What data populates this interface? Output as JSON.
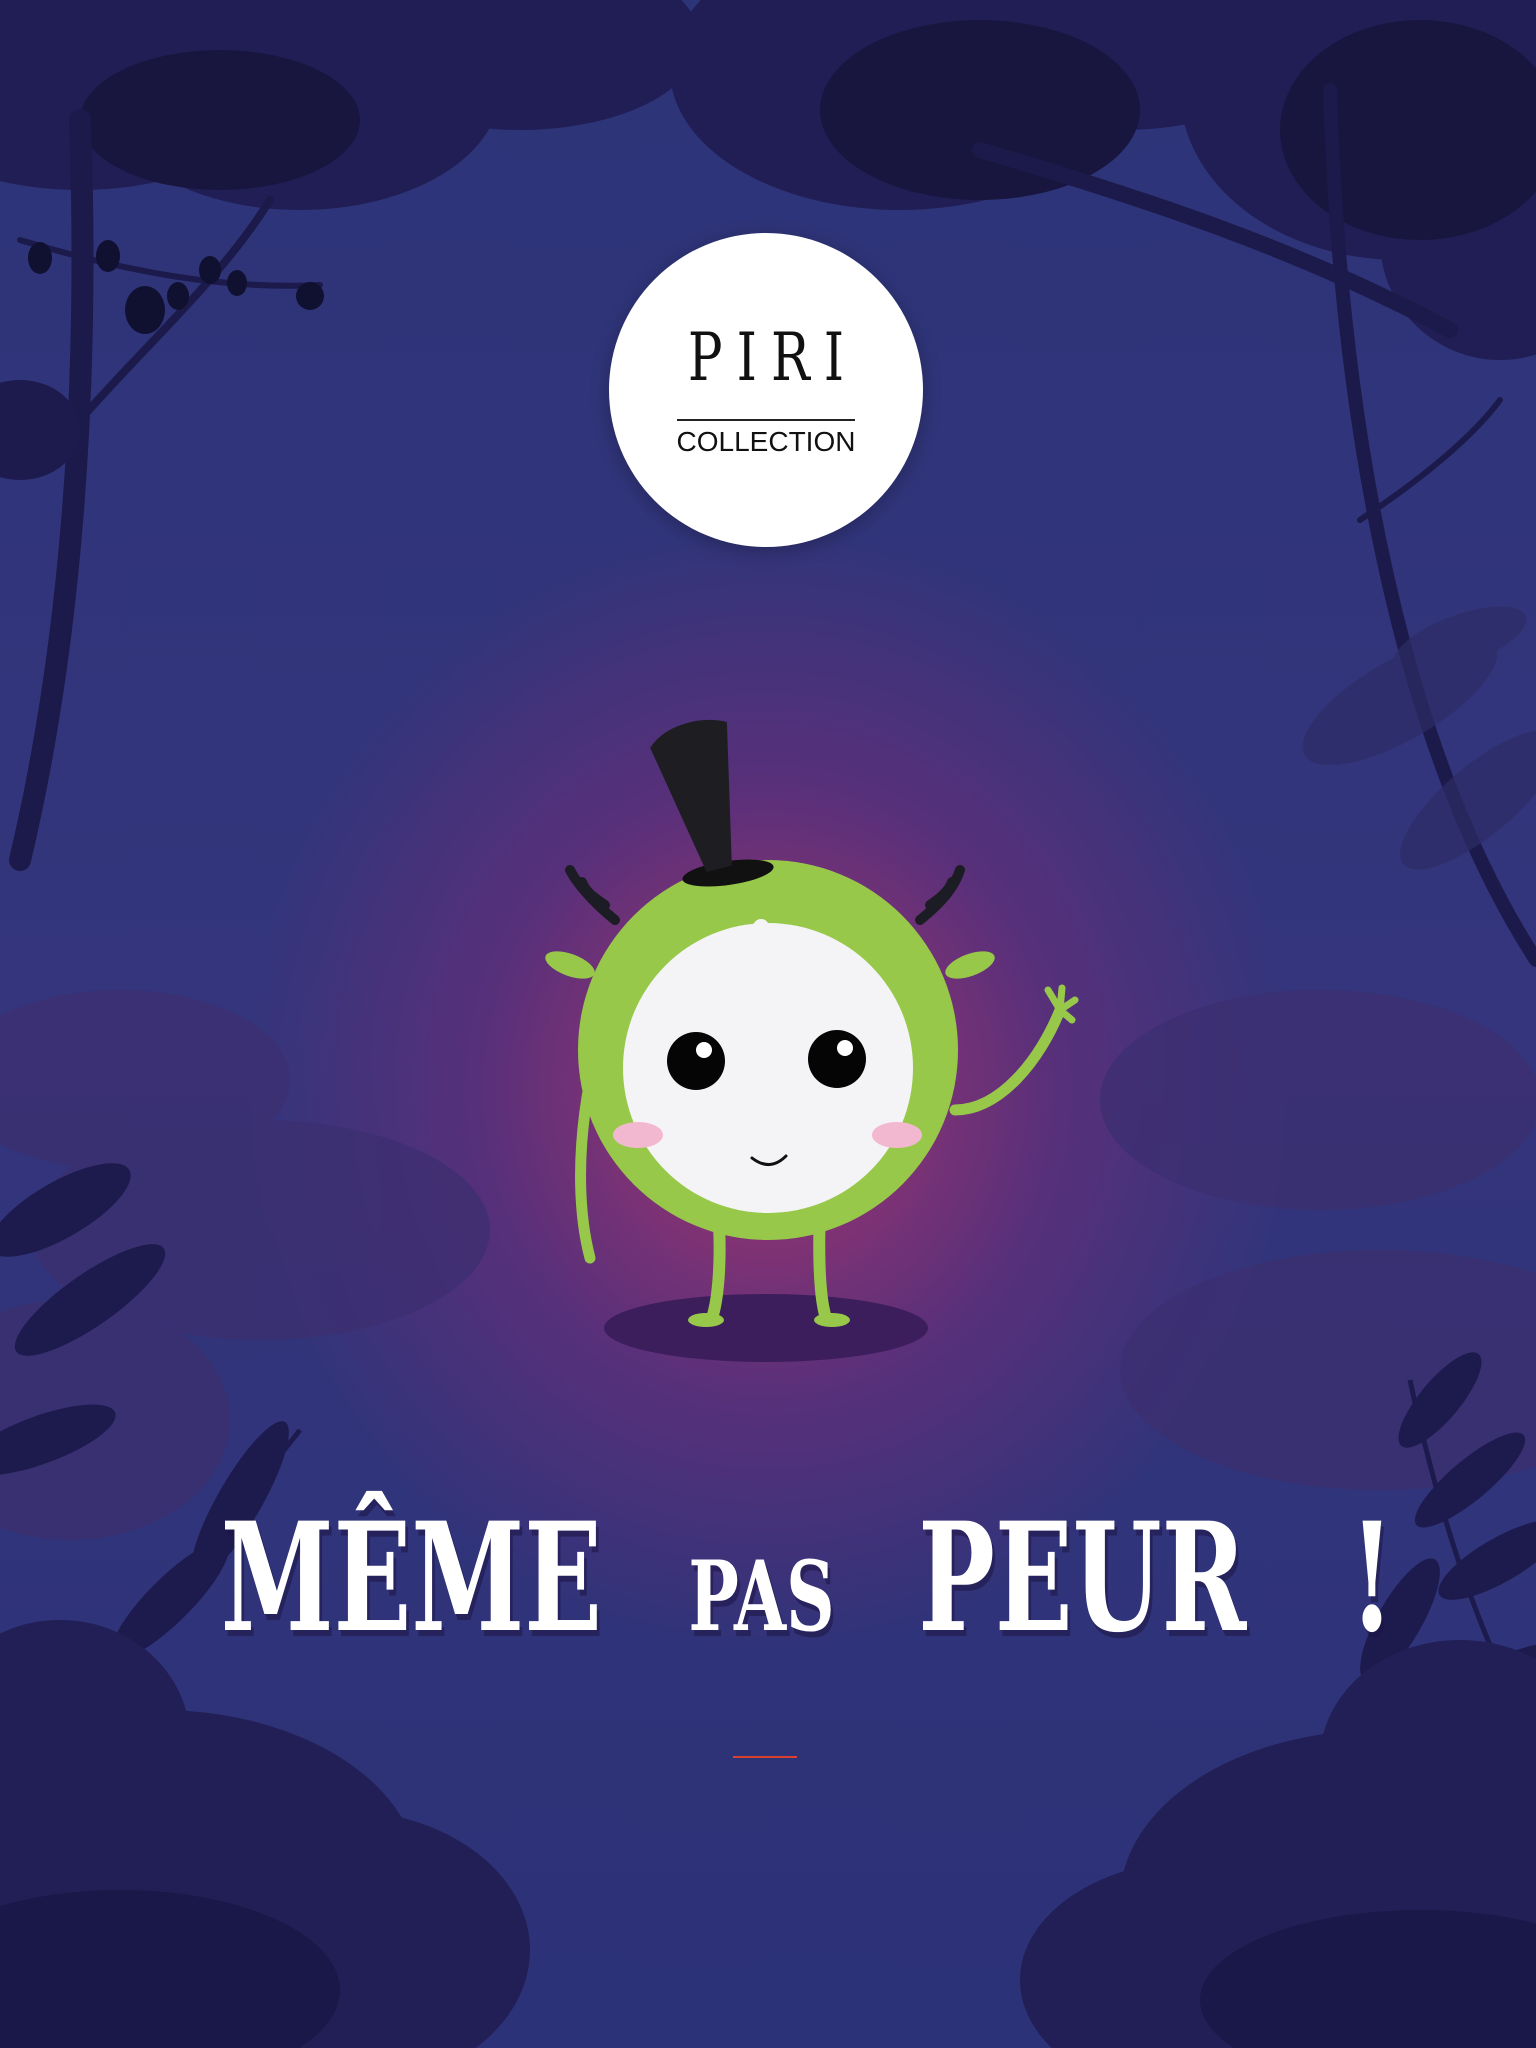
{
  "logo": {
    "wordmark": "PIRI",
    "subtitle": "COLLECTION"
  },
  "headline": {
    "word_1": "MÊME",
    "word_2": "PAS",
    "word_3": "PEUR",
    "word_4": "!"
  },
  "colors": {
    "background_blue": "#2e3478",
    "glow_magenta": "#a3356c",
    "foliage_dark": "#1f1d4e",
    "monster_green": "#98c84a",
    "accent_rule": "#d9402e"
  }
}
